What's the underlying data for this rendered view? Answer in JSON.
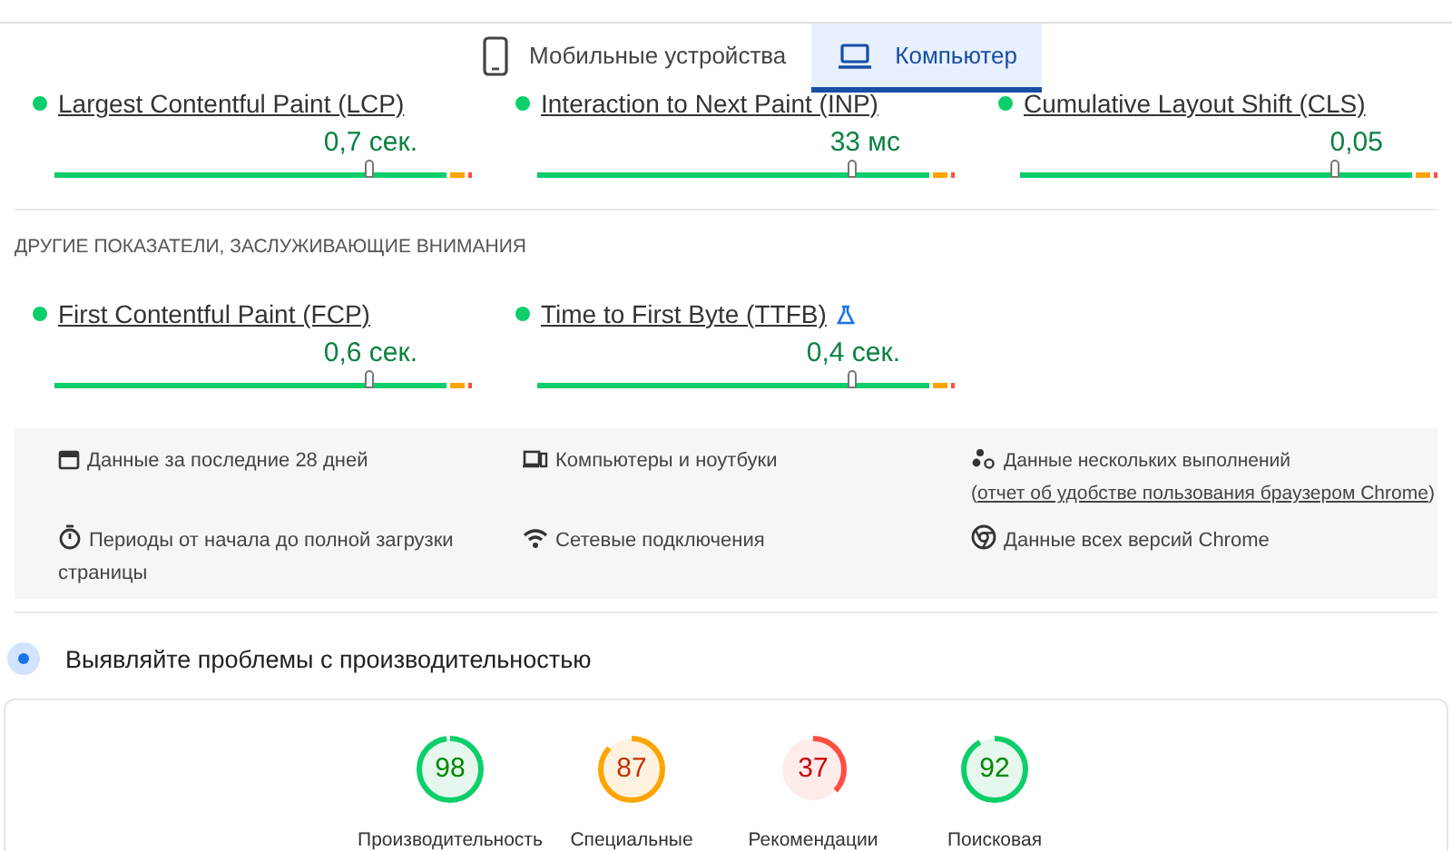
{
  "tabs": [
    {
      "label": "Мобильные устройства",
      "kind": "phone",
      "selected": false
    },
    {
      "label": "Компьютер",
      "kind": "laptop",
      "selected": true
    }
  ],
  "core_metrics": [
    {
      "name": "Largest Contentful Paint (LCP)",
      "value": "0,7 сек.",
      "level": 0.75,
      "experimental": false
    },
    {
      "name": "Interaction to Next Paint (INP)",
      "value": "33 мс",
      "level": 0.75,
      "experimental": false
    },
    {
      "name": "Cumulative Layout Shift (CLS)",
      "value": "0,05",
      "level": 0.75,
      "experimental": false
    }
  ],
  "other_metrics_heading": "ДРУГИЕ ПОКАЗАТЕЛИ, ЗАСЛУЖИВАЮЩИЕ ВНИМАНИЯ",
  "other_metrics": [
    {
      "name": "First Contentful Paint (FCP)",
      "value": "0,6 сек.",
      "level": 0.75,
      "experimental": false
    },
    {
      "name": "Time to First Byte (TTFB)",
      "value": "0,4 сек.",
      "level": 0.75,
      "experimental": true
    }
  ],
  "info": [
    {
      "kind": "calendar",
      "text": "Данные за последние 28 дней"
    },
    {
      "kind": "devices",
      "text": "Компьютеры и ноутбуки"
    },
    {
      "kind": "dots",
      "text": "Данные нескольких выполнений (",
      "link": "отчет об удобстве пользования браузером Chrome",
      "after": ")"
    },
    {
      "kind": "timer",
      "text": "Периоды от начала до полной загрузки страницы"
    },
    {
      "kind": "wifi",
      "text": "Сетевые подключения"
    },
    {
      "kind": "chrome",
      "text": "Данные всех версий Chrome"
    }
  ],
  "diagnose_heading": "Выявляйте проблемы с производительностью",
  "scores": [
    {
      "value": "98",
      "level": 0.98,
      "label": "Производительность"
    },
    {
      "value": "87",
      "level": 0.87,
      "label": "Специальные"
    },
    {
      "value": "37",
      "level": 0.37,
      "label": "Рекомендации"
    },
    {
      "value": "92",
      "level": 0.92,
      "label": "Поисковая"
    }
  ]
}
